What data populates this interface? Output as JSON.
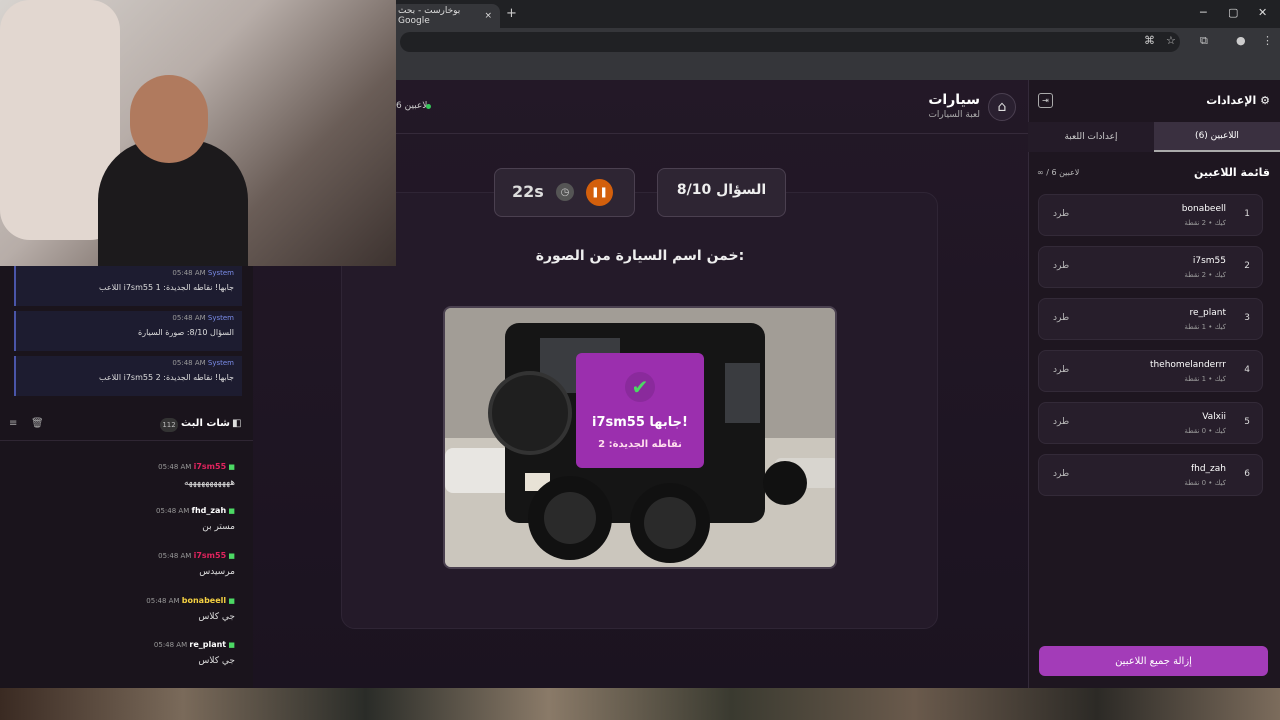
{
  "browser": {
    "tab_title": "بوخارست - بحث Google",
    "tab_close": "×",
    "new_tab": "+",
    "win_min": "─",
    "win_max": "▢",
    "win_close": "✕"
  },
  "header": {
    "title": "سيارات",
    "subtitle": "لعبة السيارات",
    "players_online": "6 لاعبين"
  },
  "game": {
    "timer": "22s",
    "question_label": "السؤال 8/10",
    "prompt": "خمن اسم السيارة من الصورة:",
    "correct_title": "i7sm55 جابها!",
    "correct_sub": "نقاطه الجديدة: 2"
  },
  "settings": {
    "title": "الإعدادات",
    "tab_players": "اللاعبين (6)",
    "tab_game": "إعدادات اللعبة",
    "list_title": "قائمة اللاعبين",
    "list_count": "∞ / 6 لاعبين",
    "kick_label": "طرد",
    "remove_all": "إزالة جميع اللاعبين",
    "players": [
      {
        "rank": "1",
        "name": "bonabeell",
        "sub": "كيك • 2 نقطة"
      },
      {
        "rank": "2",
        "name": "i7sm55",
        "sub": "كيك • 2 نقطة"
      },
      {
        "rank": "3",
        "name": "re_plant",
        "sub": "كيك • 1 نقطة"
      },
      {
        "rank": "4",
        "name": "thehomelanderrr",
        "sub": "كيك • 1 نقطة"
      },
      {
        "rank": "5",
        "name": "Valxii",
        "sub": "كيك • 0 نقطة"
      },
      {
        "rank": "6",
        "name": "fhd_zah",
        "sub": "كيك • 0 نقطة"
      }
    ]
  },
  "system_messages": [
    {
      "time": "05:48 AM",
      "sender": "System",
      "text": "اللاعب i7sm55 جابها! نقاطه الجديدة: 1"
    },
    {
      "time": "05:48 AM",
      "sender": "System",
      "text": "السؤال 8/10: صورة السيارة"
    },
    {
      "time": "05:48 AM",
      "sender": "System",
      "text": "اللاعب i7sm55 جابها! نقاطه الجديدة: 2"
    }
  ],
  "chat": {
    "title": "شات البث",
    "count": "112",
    "messages": [
      {
        "time": "05:48 AM",
        "user": "i7sm55",
        "color": "#e0245e",
        "text": "هههههههههههه"
      },
      {
        "time": "05:48 AM",
        "user": "fhd_zah",
        "color": "#ffffff",
        "text": "مستر بن"
      },
      {
        "time": "05:48 AM",
        "user": "i7sm55",
        "color": "#e0245e",
        "text": "مرسيدس"
      },
      {
        "time": "05:48 AM",
        "user": "bonabeell",
        "color": "#f5d142",
        "text": "جي كلاس"
      },
      {
        "time": "05:48 AM",
        "user": "re_plant",
        "color": "#ffffff",
        "text": "جي كلاس"
      }
    ]
  },
  "colors": {
    "accent": "#a33cb8",
    "pause": "#d35f0c",
    "success": "#4cd964"
  }
}
